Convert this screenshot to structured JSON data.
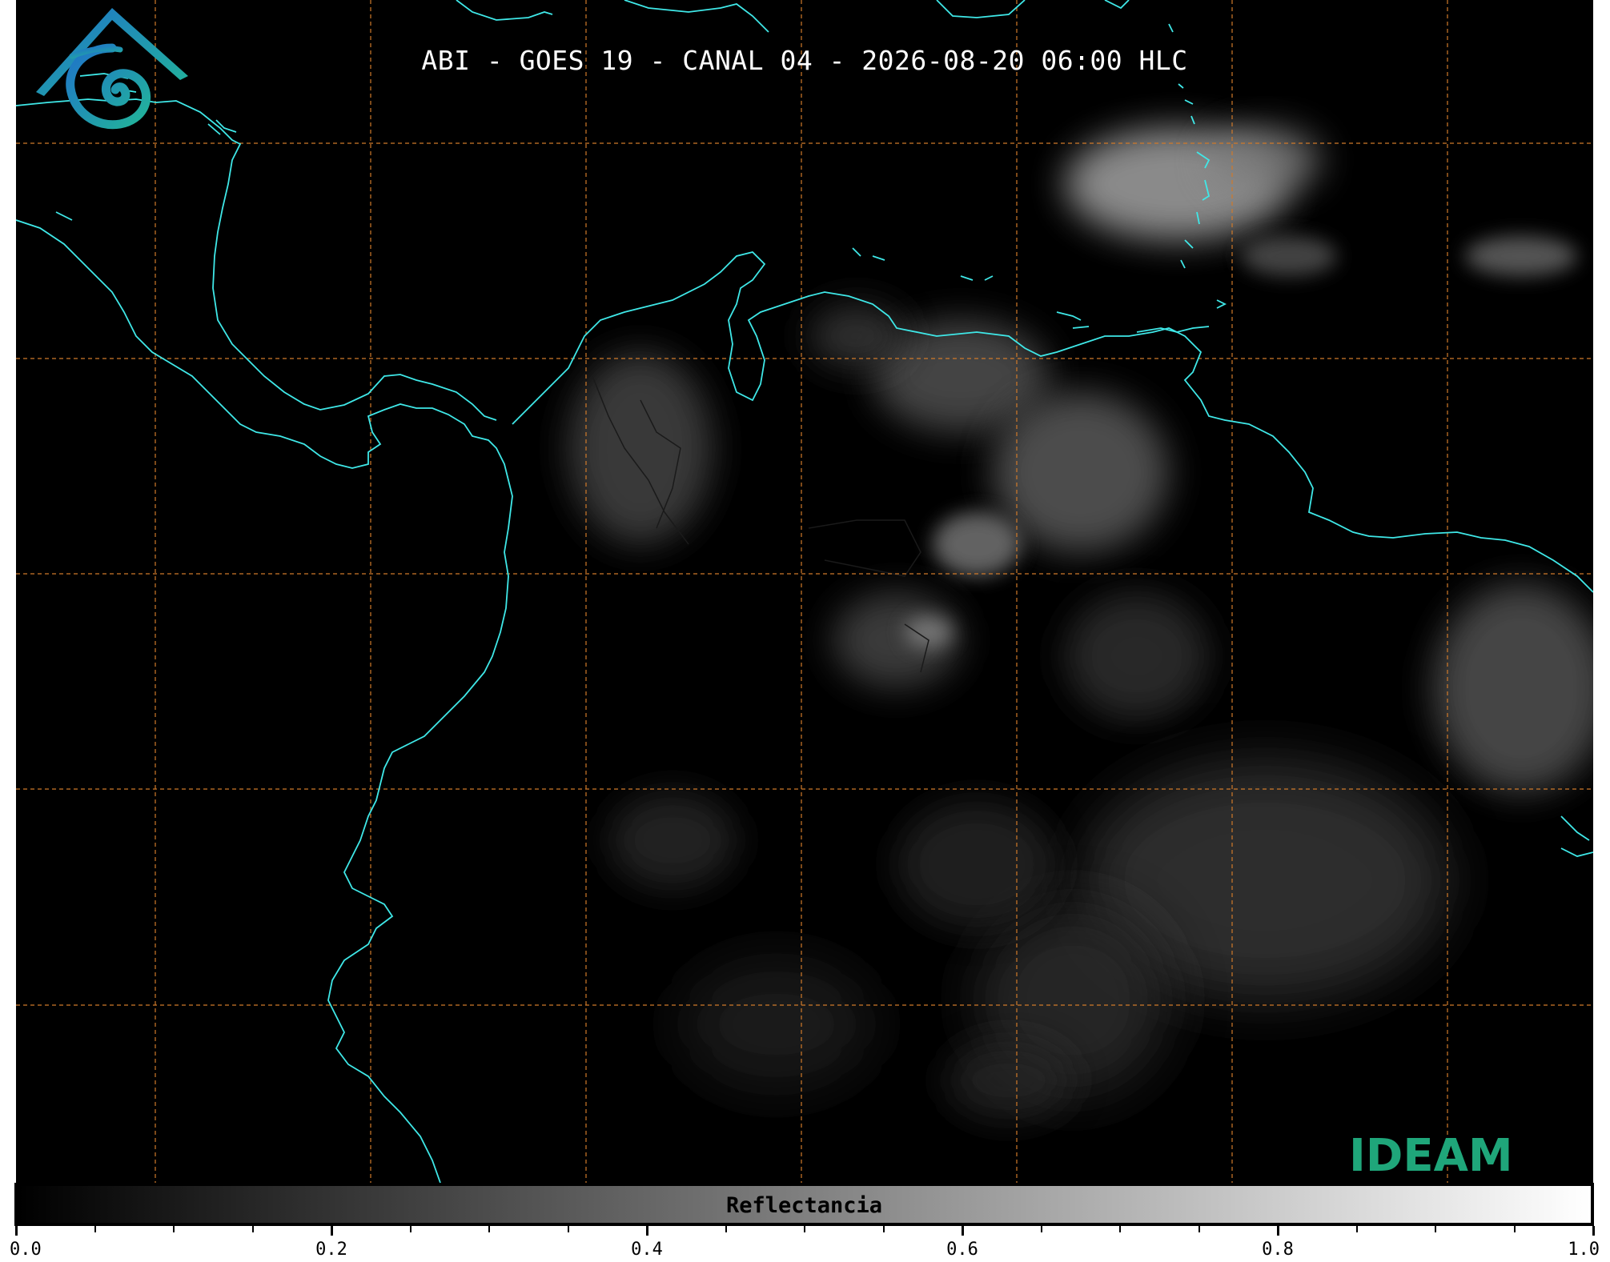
{
  "title": "ABI - GOES 19 - CANAL 04 - 2026-08-20 06:00 HLC",
  "logo": {
    "text": "IDEAM"
  },
  "colorbar": {
    "label": "Reflectancia",
    "range": [
      0.0,
      1.0
    ],
    "ticks": [
      "0.0",
      "0.2",
      "0.4",
      "0.6",
      "0.8",
      "1.0"
    ],
    "colors": {
      "low": "#000000",
      "high": "#ffffff"
    }
  },
  "map_style": {
    "background": "#000000",
    "coastline_color": "#3fe8e8",
    "graticule_color": "#d07a2a",
    "graticule_style": "dashed",
    "border_color": "#1a1a1a"
  }
}
